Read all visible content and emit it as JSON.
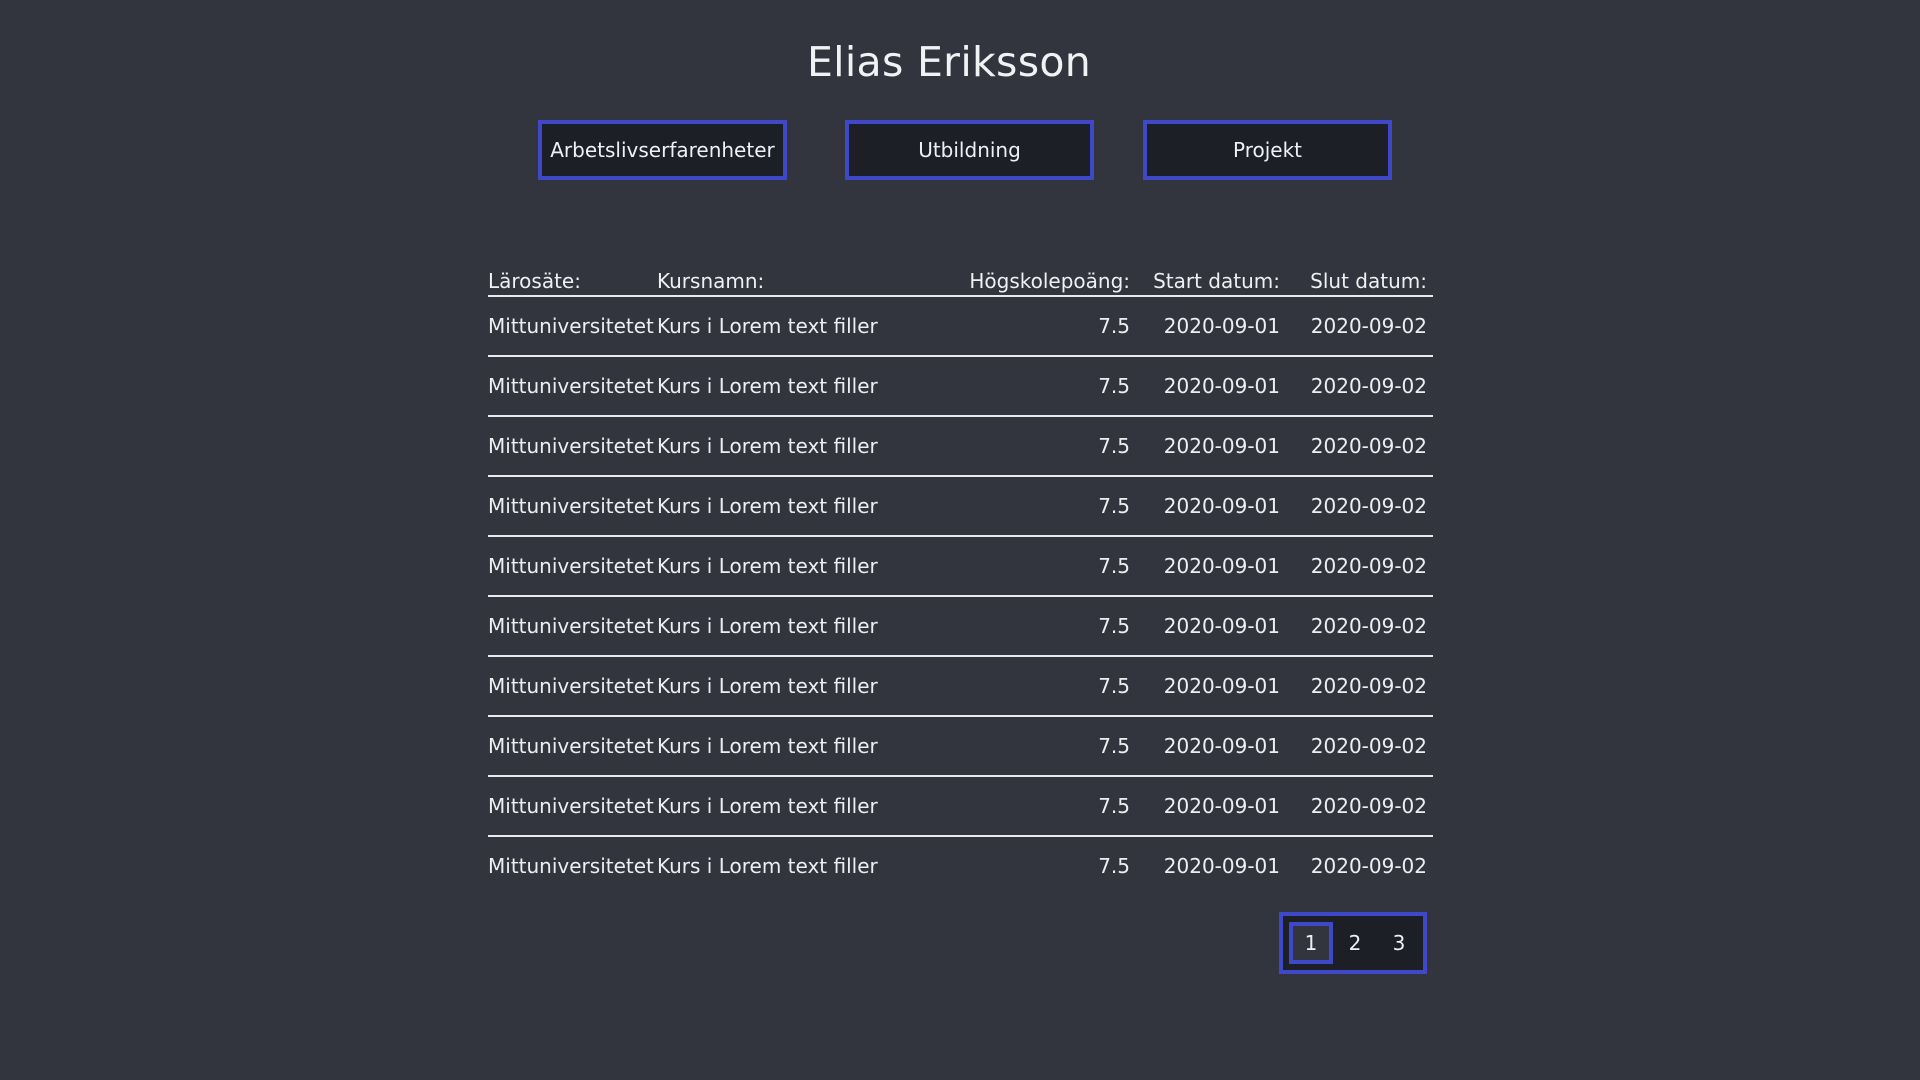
{
  "page": {
    "title": "Elias Eriksson"
  },
  "nav": {
    "buttons": [
      {
        "label": "Arbetslivserfarenheter"
      },
      {
        "label": "Utbildning"
      },
      {
        "label": "Projekt"
      }
    ]
  },
  "table": {
    "headers": {
      "school": "Lärosäte:",
      "course": "Kursnamn:",
      "points": "Högskolepoäng:",
      "start": "Start datum:",
      "end": "Slut datum:"
    },
    "rows": [
      {
        "school": "Mittuniversitetet",
        "course": "Kurs i Lorem text filler",
        "points": "7.5",
        "start": "2020-09-01",
        "end": "2020-09-02"
      },
      {
        "school": "Mittuniversitetet",
        "course": "Kurs i Lorem text filler",
        "points": "7.5",
        "start": "2020-09-01",
        "end": "2020-09-02"
      },
      {
        "school": "Mittuniversitetet",
        "course": "Kurs i Lorem text filler",
        "points": "7.5",
        "start": "2020-09-01",
        "end": "2020-09-02"
      },
      {
        "school": "Mittuniversitetet",
        "course": "Kurs i Lorem text filler",
        "points": "7.5",
        "start": "2020-09-01",
        "end": "2020-09-02"
      },
      {
        "school": "Mittuniversitetet",
        "course": "Kurs i Lorem text filler",
        "points": "7.5",
        "start": "2020-09-01",
        "end": "2020-09-02"
      },
      {
        "school": "Mittuniversitetet",
        "course": "Kurs i Lorem text filler",
        "points": "7.5",
        "start": "2020-09-01",
        "end": "2020-09-02"
      },
      {
        "school": "Mittuniversitetet",
        "course": "Kurs i Lorem text filler",
        "points": "7.5",
        "start": "2020-09-01",
        "end": "2020-09-02"
      },
      {
        "school": "Mittuniversitetet",
        "course": "Kurs i Lorem text filler",
        "points": "7.5",
        "start": "2020-09-01",
        "end": "2020-09-02"
      },
      {
        "school": "Mittuniversitetet",
        "course": "Kurs i Lorem text filler",
        "points": "7.5",
        "start": "2020-09-01",
        "end": "2020-09-02"
      },
      {
        "school": "Mittuniversitetet",
        "course": "Kurs i Lorem text filler",
        "points": "7.5",
        "start": "2020-09-01",
        "end": "2020-09-02"
      }
    ]
  },
  "pagination": {
    "pages": [
      "1",
      "2",
      "3"
    ],
    "current": "1"
  },
  "colors": {
    "background": "#32353d",
    "accent": "#3f48c8",
    "button_bg": "#1d1f26",
    "text": "#eceff2"
  }
}
